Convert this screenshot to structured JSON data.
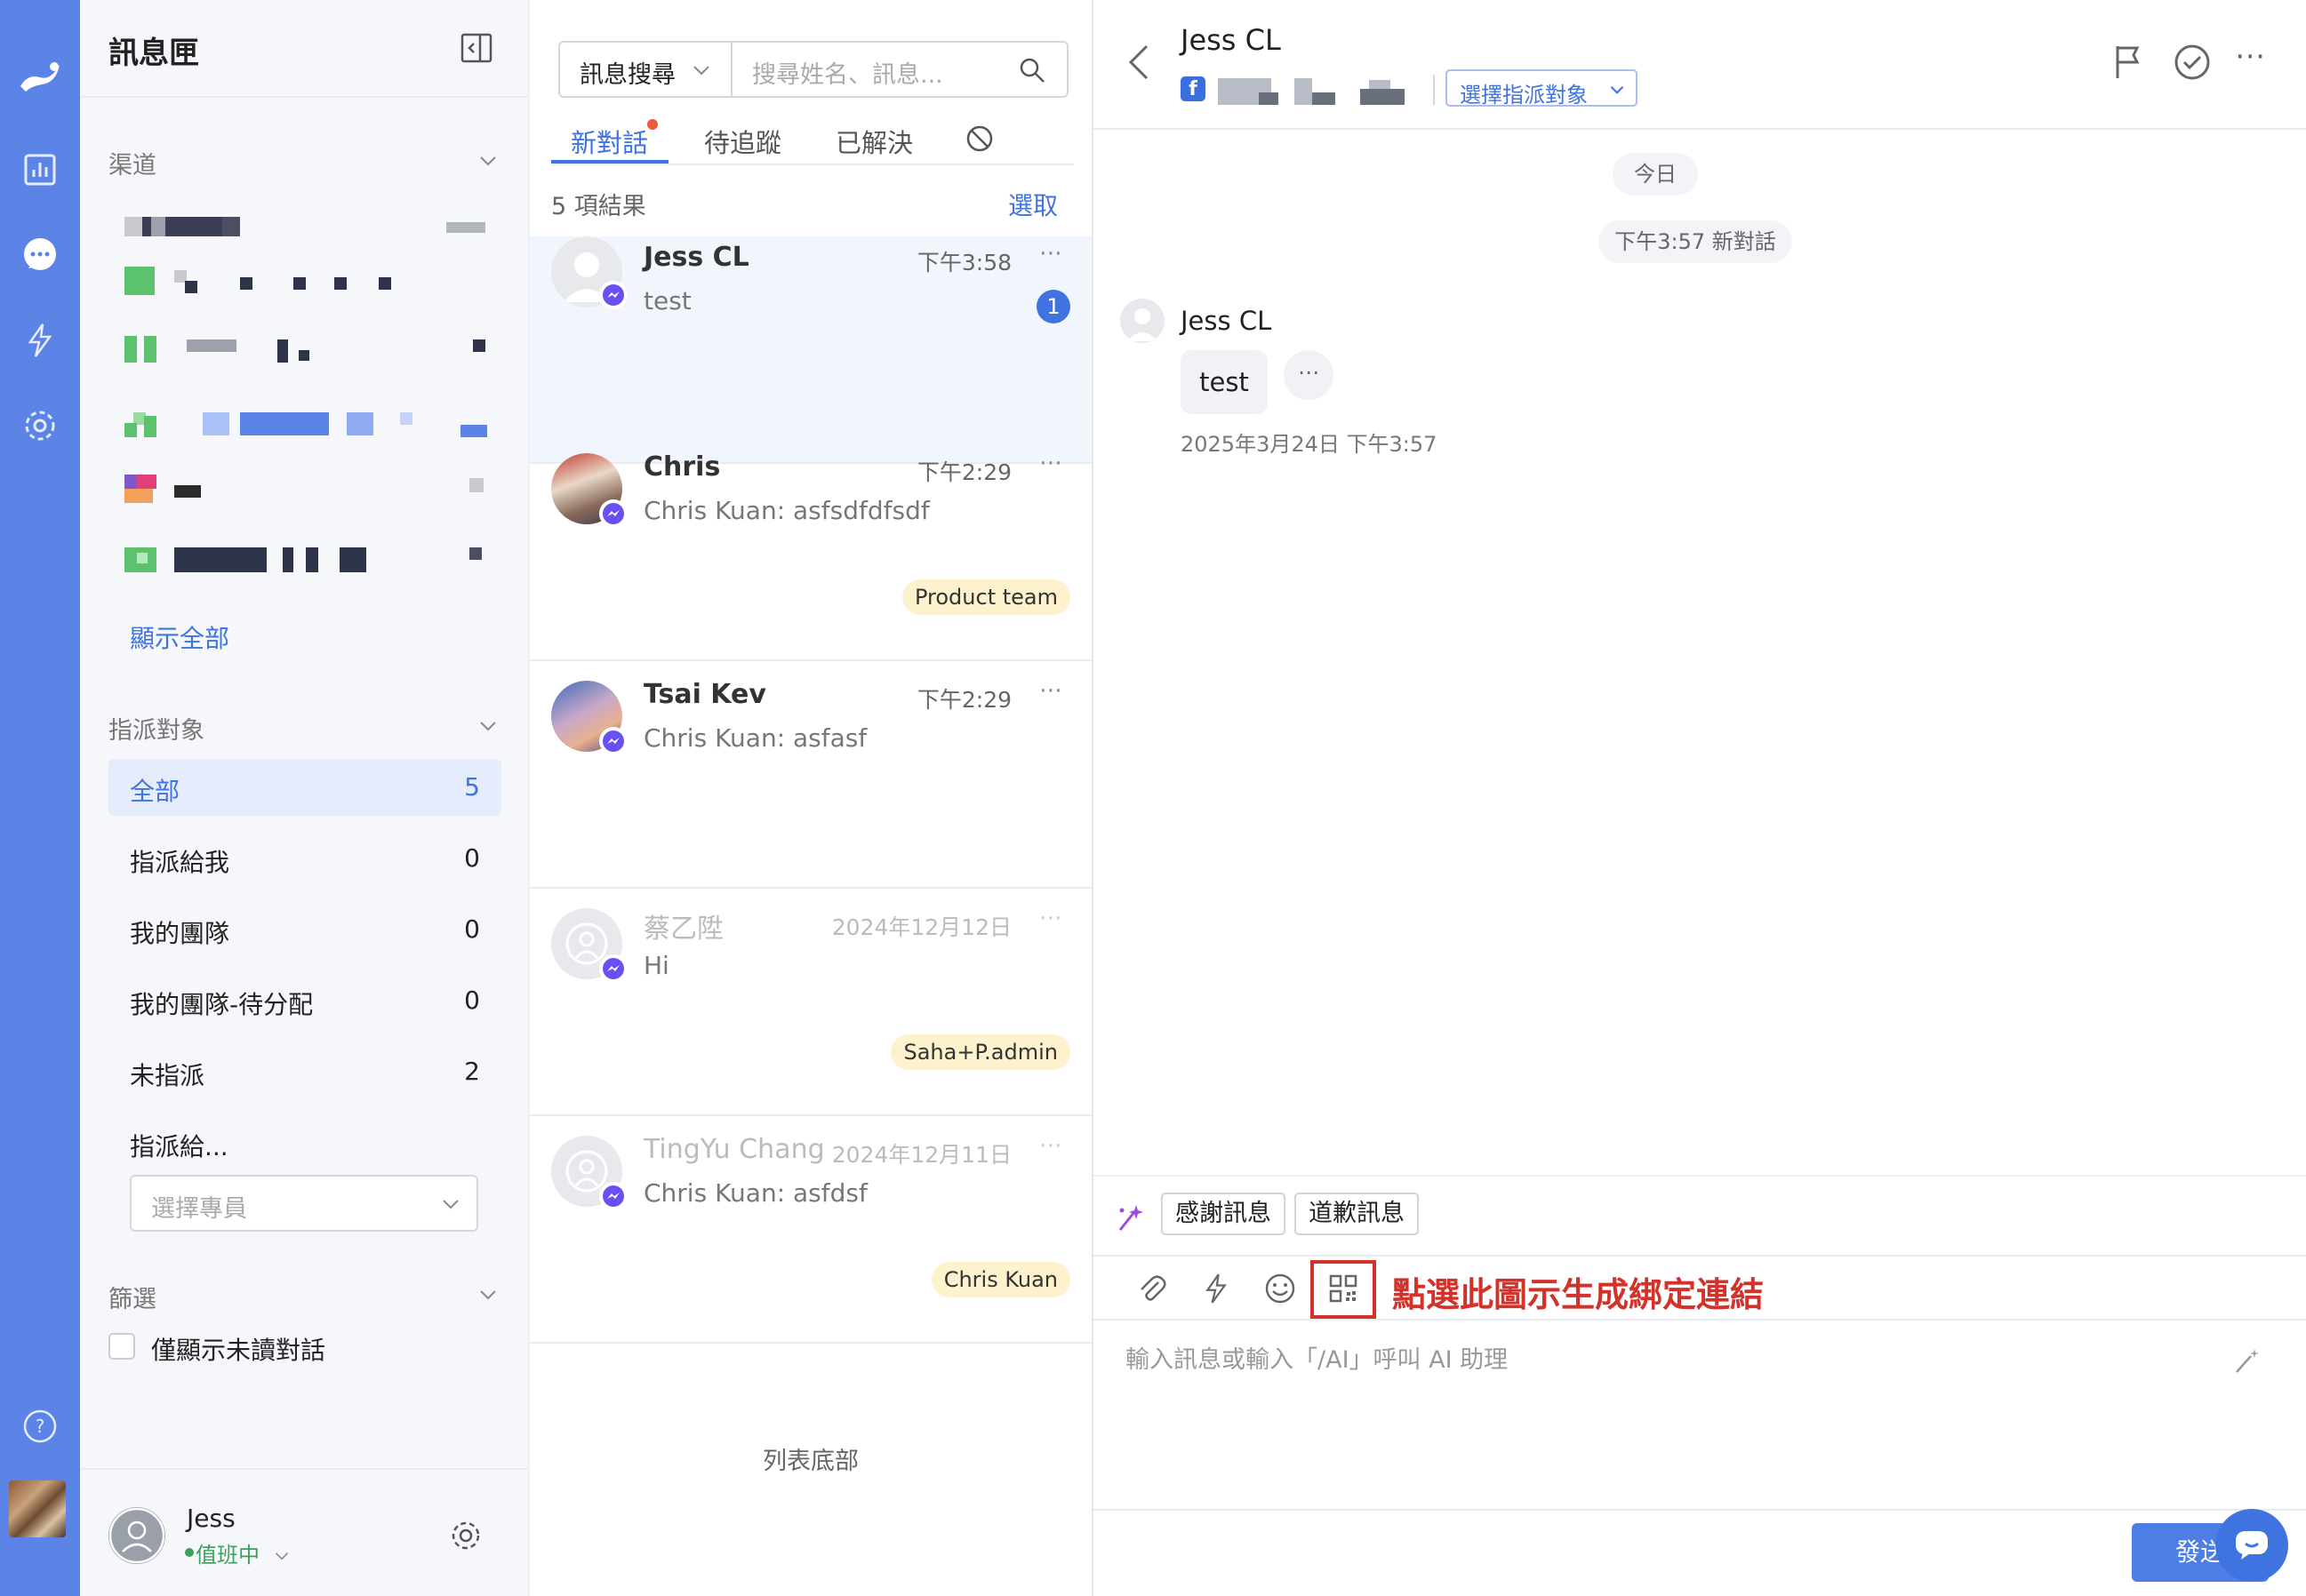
{
  "sidebar": {
    "title": "訊息匣",
    "channels_title": "渠道",
    "show_all": "顯示全部",
    "assign_title": "指派對象",
    "assign_items": [
      {
        "label": "全部",
        "count": "5"
      },
      {
        "label": "指派給我",
        "count": "0"
      },
      {
        "label": "我的團隊",
        "count": "0"
      },
      {
        "label": "我的團隊-待分配",
        "count": "0"
      },
      {
        "label": "未指派",
        "count": "2"
      }
    ],
    "assign_to_label": "指派給...",
    "member_select_placeholder": "選擇專員",
    "filter_title": "篩選",
    "unread_only_label": "僅顯示未讀對話",
    "user_name": "Jess",
    "user_status": "值班中"
  },
  "list": {
    "search_type": "訊息搜尋",
    "search_placeholder": "搜尋姓名、訊息...",
    "tabs": [
      "新對話",
      "待追蹤",
      "已解決"
    ],
    "result_count": "5 項結果",
    "select_label": "選取",
    "conversations": [
      {
        "name": "Jess CL",
        "time": "下午3:58",
        "preview": "test",
        "unread": "1",
        "tag": ""
      },
      {
        "name": "Chris",
        "time": "下午2:29",
        "preview": "Chris Kuan: asfsdfdfsdf",
        "unread": "",
        "tag": "Product team"
      },
      {
        "name": "Tsai Kev",
        "time": "下午2:29",
        "preview": "Chris Kuan: asfasf",
        "unread": "",
        "tag": ""
      },
      {
        "name": "蔡乙陞",
        "time": "2024年12月12日",
        "preview": "Hi",
        "unread": "",
        "tag": "Saha+P.admin"
      },
      {
        "name": "TingYu Chang",
        "time": "2024年12月11日",
        "preview": "Chris Kuan: asfdsf",
        "unread": "",
        "tag": "Chris Kuan"
      }
    ],
    "list_end": "列表底部"
  },
  "chat": {
    "contact_name": "Jess CL",
    "assign_select": "選擇指派對象",
    "date_pill": "今日",
    "new_conv_pill": "下午3:57 新對話",
    "sender": "Jess CL",
    "message": "test",
    "message_time": "2025年3月24日 下午3:57",
    "quick_replies": [
      "感謝訊息",
      "道歉訊息"
    ],
    "annotation": "點選此圖示生成綁定連結",
    "input_placeholder": "輸入訊息或輸入「/AI」呼叫 AI 助理",
    "send_label": "發送"
  },
  "colors": {
    "rail": "#5b84e6",
    "accent": "#3f73e0",
    "annotation_red": "#d3322a",
    "tag_bg": "#fdf2cd"
  }
}
